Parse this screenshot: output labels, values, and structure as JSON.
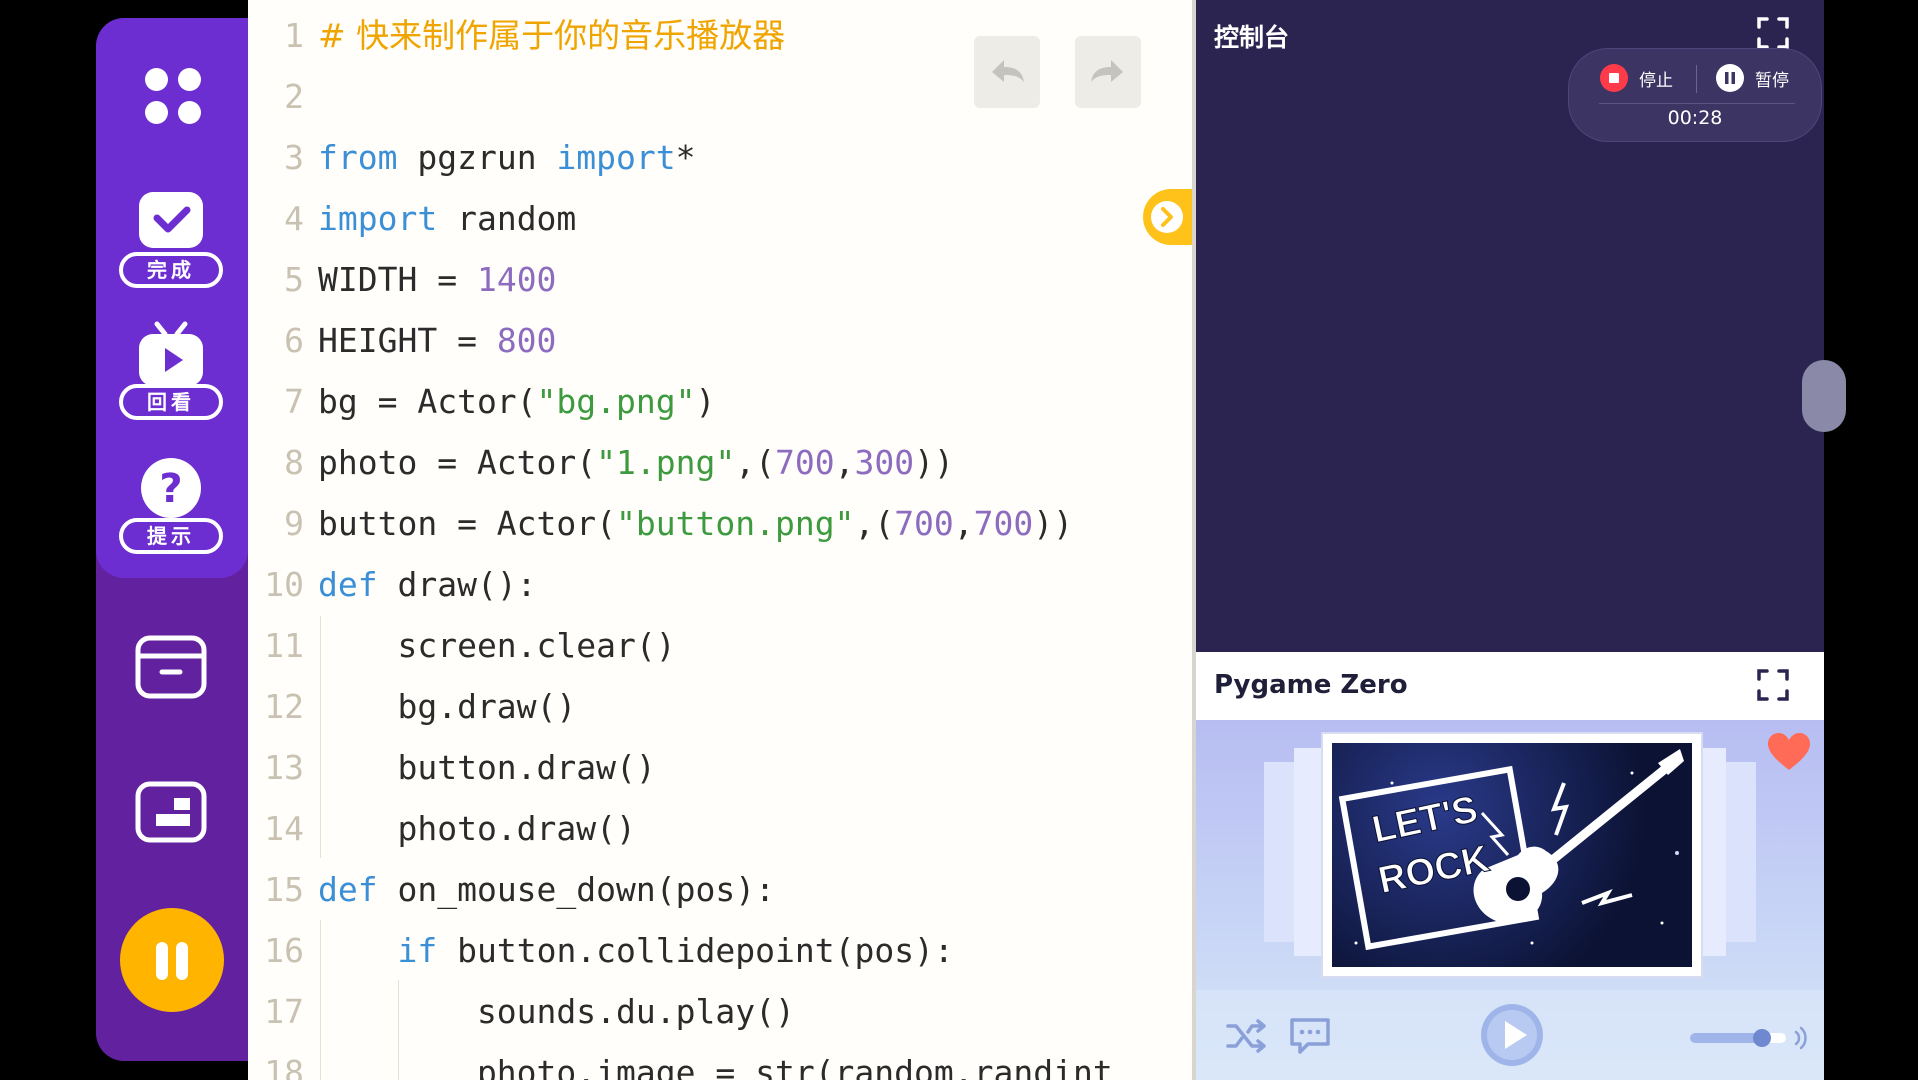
{
  "sidebar": {
    "complete_label": "完成",
    "replay_label": "回看",
    "hint_label": "提示"
  },
  "editor": {
    "lines": [
      {
        "n": "1",
        "html": "<span class=\"cmt\"># 快来制作属于你的音乐播放器</span>"
      },
      {
        "n": "2",
        "html": ""
      },
      {
        "n": "3",
        "html": "<span class=\"kw\">from</span> pgzrun <span class=\"kw\">import</span>*"
      },
      {
        "n": "4",
        "html": "<span class=\"kw\">import</span> random"
      },
      {
        "n": "5",
        "html": "WIDTH = <span class=\"num\">1400</span>"
      },
      {
        "n": "6",
        "html": "HEIGHT = <span class=\"num\">800</span>"
      },
      {
        "n": "7",
        "html": "bg = Actor(<span class=\"str\">\"bg.png\"</span>)"
      },
      {
        "n": "8",
        "html": "photo = Actor(<span class=\"str\">\"1.png\"</span>,(<span class=\"num\">700</span>,<span class=\"num\">300</span>))"
      },
      {
        "n": "9",
        "html": "button = Actor(<span class=\"str\">\"button.png\"</span>,(<span class=\"num\">700</span>,<span class=\"num\">700</span>))"
      },
      {
        "n": "10",
        "html": "<span class=\"kw\">def</span> draw():"
      },
      {
        "n": "11",
        "html": "    screen.clear()"
      },
      {
        "n": "12",
        "html": "    bg.draw()"
      },
      {
        "n": "13",
        "html": "    button.draw()"
      },
      {
        "n": "14",
        "html": "    photo.draw()"
      },
      {
        "n": "15",
        "html": "<span class=\"kw\">def</span> on_mouse_down(pos):"
      },
      {
        "n": "16",
        "html": "    <span class=\"kw\">if</span> button.collidepoint(pos):"
      },
      {
        "n": "17",
        "html": "        sounds.du.play()"
      },
      {
        "n": "18",
        "html": "        photo.image = str(random.randint"
      }
    ]
  },
  "console": {
    "title": "控制台",
    "stop_label": "停止",
    "pause_label": "暂停",
    "timer": "00:28"
  },
  "pygame": {
    "title": "Pygame Zero",
    "card_text_line1": "LET'S",
    "card_text_line2": "ROCK",
    "volume": 0.75
  }
}
